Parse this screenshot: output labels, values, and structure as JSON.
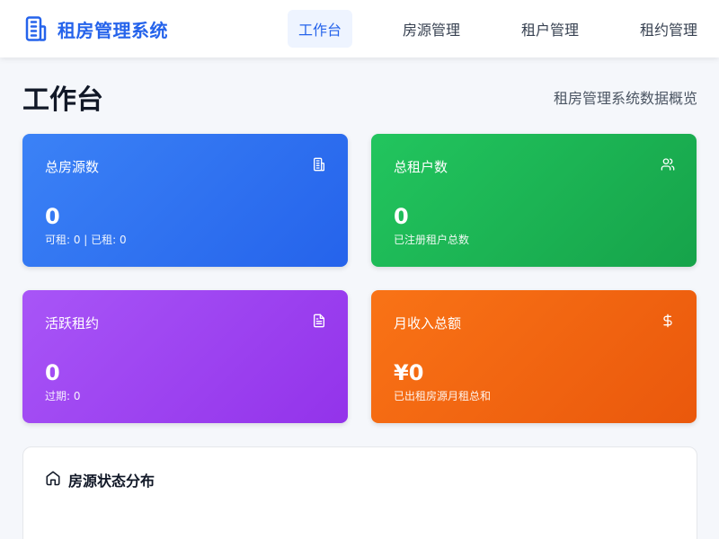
{
  "header": {
    "brand_icon": "building-icon",
    "brand_name": "租房管理系统",
    "nav": [
      {
        "label": "工作台",
        "active": true
      },
      {
        "label": "房源管理",
        "active": false
      },
      {
        "label": "租户管理",
        "active": false
      },
      {
        "label": "租约管理",
        "active": false
      }
    ]
  },
  "page": {
    "title": "工作台",
    "subtitle": "租房管理系统数据概览"
  },
  "cards": [
    {
      "title": "总房源数",
      "icon": "building-icon",
      "value": "0",
      "note": "可租: 0 | 已租: 0",
      "color": "#3b82f6"
    },
    {
      "title": "总租户数",
      "icon": "users-icon",
      "value": "0",
      "note": "已注册租户总数",
      "color": "#22c55e"
    },
    {
      "title": "活跃租约",
      "icon": "document-icon",
      "value": "0",
      "note": "过期: 0",
      "color": "#a855f7"
    },
    {
      "title": "月收入总额",
      "icon": "dollar-icon",
      "value": "¥0",
      "note": "已出租房源月租总和",
      "color": "#f97316"
    }
  ],
  "panel": {
    "icon": "home-icon",
    "title": "房源状态分布"
  }
}
